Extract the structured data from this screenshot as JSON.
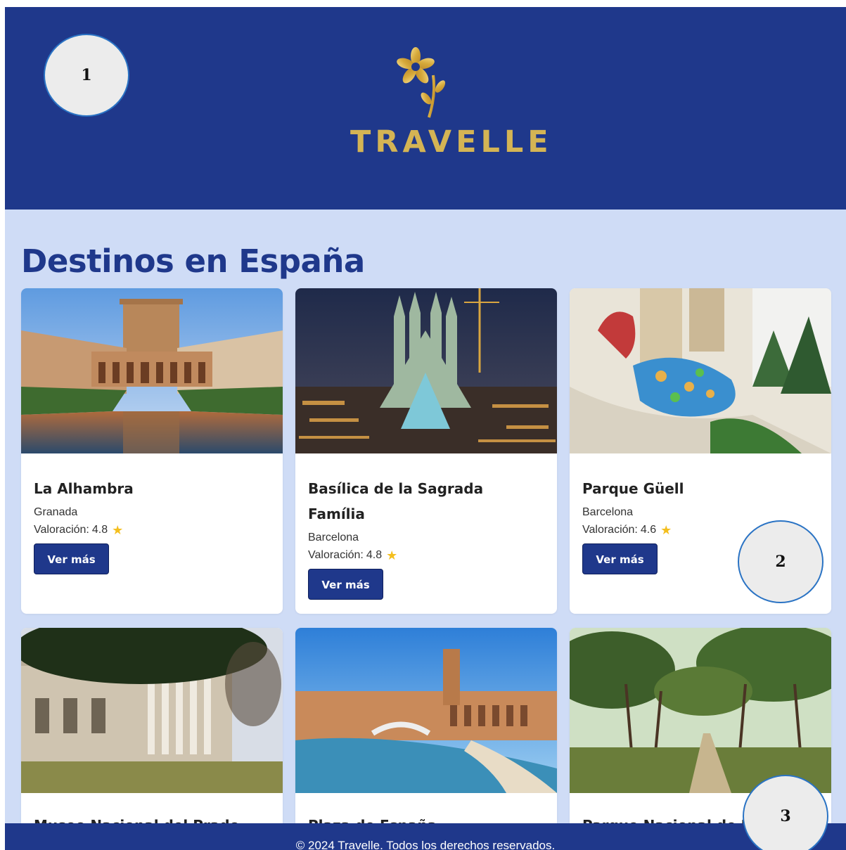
{
  "header": {
    "brand": "TRAVELLE"
  },
  "markers": [
    "1",
    "2",
    "3"
  ],
  "section": {
    "title": "Destinos en España"
  },
  "cards": [
    {
      "title": "La Alhambra",
      "city": "Granada",
      "rating_label": "Valoración:",
      "rating": "4.8",
      "button": "Ver más"
    },
    {
      "title": "Basílica de la Sagrada Família",
      "city": "Barcelona",
      "rating_label": "Valoración:",
      "rating": "4.8",
      "button": "Ver más"
    },
    {
      "title": "Parque Güell",
      "city": "Barcelona",
      "rating_label": "Valoración:",
      "rating": "4.6",
      "button": "Ver más"
    },
    {
      "title": "Museo Nacional del Prado",
      "city": "",
      "rating_label": "",
      "rating": "",
      "button": ""
    },
    {
      "title": "Plaza de España",
      "city": "",
      "rating_label": "",
      "rating": "",
      "button": ""
    },
    {
      "title": "Parque Nacional de Doñana",
      "city": "",
      "rating_label": "",
      "rating": "",
      "button": ""
    }
  ],
  "footer": {
    "text": "© 2024 Travelle. Todos los derechos reservados."
  },
  "colors": {
    "primary": "#1f388b",
    "background": "#cfdcf6",
    "gold": "#d4b454",
    "star": "#f4bf1e"
  }
}
